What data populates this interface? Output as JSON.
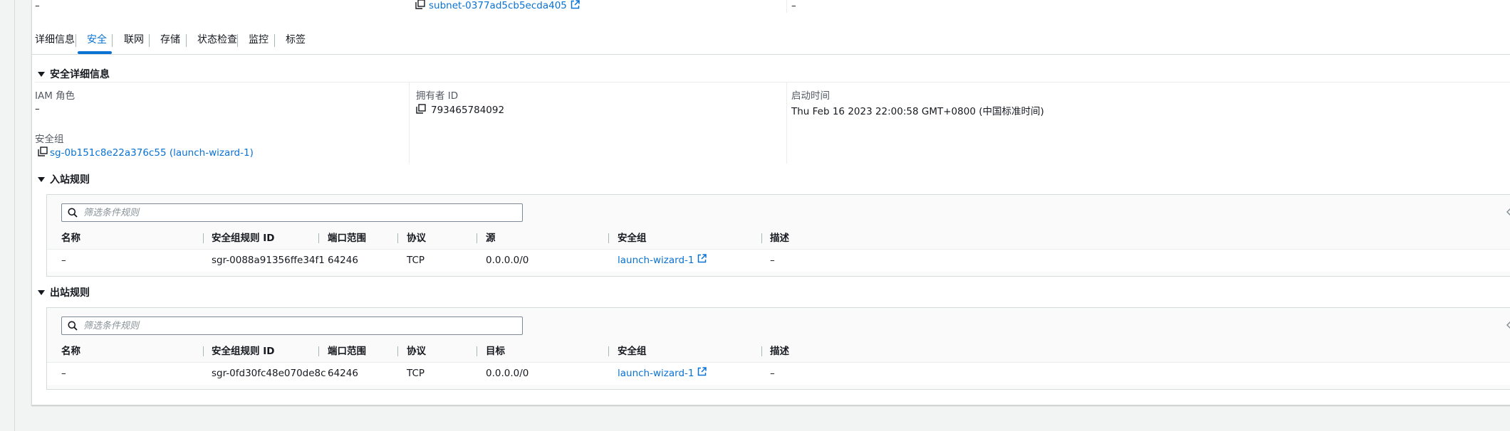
{
  "top_row": {
    "left_value": "–",
    "subnet_link": "subnet-0377ad5cb5ecda405",
    "right_value": "–"
  },
  "tabs": [
    {
      "label": "详细信息"
    },
    {
      "label": "安全"
    },
    {
      "label": "联网"
    },
    {
      "label": "存储"
    },
    {
      "label": "状态检查"
    },
    {
      "label": "监控"
    },
    {
      "label": "标签"
    }
  ],
  "security_details": {
    "title": "安全详细信息",
    "iam_role_label": "IAM 角色",
    "iam_role_value": "–",
    "owner_id_label": "拥有者 ID",
    "owner_id_value": "793465784092",
    "launch_time_label": "启动时间",
    "launch_time_value": "Thu Feb 16 2023 22:00:58 GMT+0800 (中国标准时间)",
    "security_group_label": "安全组",
    "security_group_link": "sg-0b151c8e22a376c55 (launch-wizard-1)"
  },
  "inbound": {
    "title": "入站规则",
    "search_placeholder": "筛选条件规则",
    "columns": [
      "名称",
      "安全组规则 ID",
      "端口范围",
      "协议",
      "源",
      "安全组",
      "描述"
    ],
    "rows": [
      {
        "name": "–",
        "rule_id": "sgr-0088a91356ffe34f1",
        "port": "64246",
        "protocol": "TCP",
        "source": "0.0.0.0/0",
        "sg": "launch-wizard-1",
        "desc": "–"
      }
    ]
  },
  "outbound": {
    "title": "出站规则",
    "search_placeholder": "筛选条件规则",
    "columns": [
      "名称",
      "安全组规则 ID",
      "端口范围",
      "协议",
      "目标",
      "安全组",
      "描述"
    ],
    "rows": [
      {
        "name": "–",
        "rule_id": "sgr-0fd30fc48e070de8c",
        "port": "64246",
        "protocol": "TCP",
        "source": "0.0.0.0/0",
        "sg": "launch-wizard-1",
        "desc": "–"
      }
    ]
  },
  "colors": {
    "link": "#0972d3",
    "active_tab": "#0972d3",
    "border": "#d5dbdb",
    "page_bg": "#f2f3f3"
  }
}
